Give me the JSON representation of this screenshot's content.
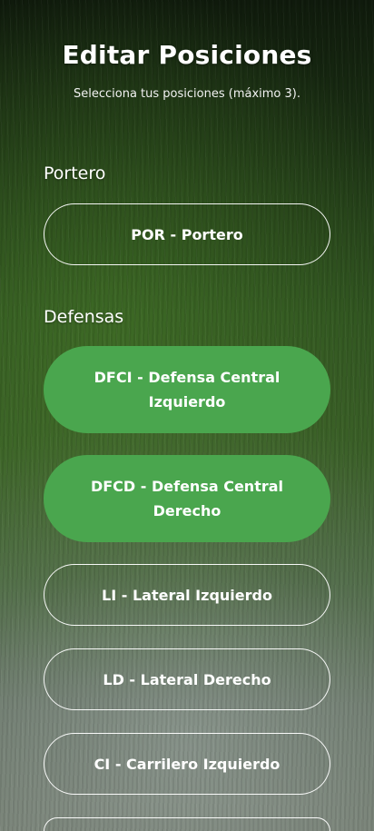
{
  "header": {
    "title": "Editar Posiciones",
    "subtitle": "Selecciona tus posiciones (máximo 3)."
  },
  "sections": {
    "goalkeeper": {
      "label": "Portero"
    },
    "defense": {
      "label": "Defensas"
    }
  },
  "options": [
    {
      "label": "POR - Portero",
      "selected": false
    },
    {
      "label": "DFCI - Defensa Central Izquierdo",
      "selected": true
    },
    {
      "label": "DFCD - Defensa Central Derecho",
      "selected": true
    },
    {
      "label": "LI - Lateral Izquierdo",
      "selected": false
    },
    {
      "label": "LD - Lateral Derecho",
      "selected": false
    },
    {
      "label": "CI - Carrilero Izquierdo",
      "selected": false
    },
    {
      "label": "",
      "selected": false
    }
  ],
  "colors": {
    "selected": "#4aa64e",
    "text": "#ffffff"
  }
}
